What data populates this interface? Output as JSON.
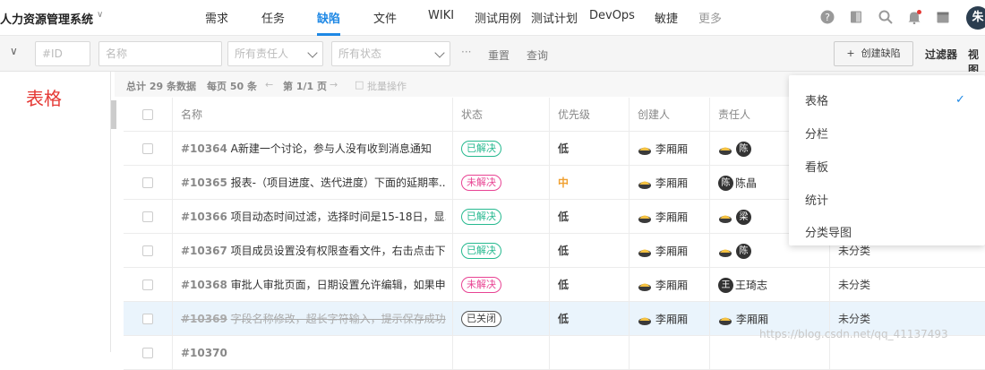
{
  "app": {
    "title": "人力资源管理系统"
  },
  "nav": {
    "items": [
      "需求",
      "任务",
      "缺陷",
      "文件",
      "WIKI",
      "测试用例",
      "测试计划",
      "DevOps",
      "敏捷",
      "更多"
    ],
    "active": "缺陷"
  },
  "user": {
    "avatar_letter": "朱"
  },
  "toolbar": {
    "id_placeholder": "#ID",
    "name_placeholder": "名称",
    "assignee_placeholder": "所有责任人",
    "status_placeholder": "所有状态",
    "more": "···",
    "reset": "重置",
    "query": "查询",
    "create_bug": "创建缺陷",
    "filter": "过滤器",
    "view": "视图"
  },
  "left_panel": {
    "annotation": "表格"
  },
  "summary": {
    "total": "总计 29 条数据",
    "per_page": "每页 50 条",
    "page": "第 1/1 页",
    "batch": "批量操作"
  },
  "table": {
    "columns": [
      "名称",
      "状态",
      "优先级",
      "创建人",
      "责任人"
    ],
    "rows": [
      {
        "id": "#10364",
        "title": "A新建一个讨论，参与人没有收到消息通知",
        "status": "已解决",
        "status_type": "solved",
        "priority": "低",
        "creator": "李厢厢",
        "assignee_initial": "陈",
        "assignee": "",
        "category": "",
        "highlight": false
      },
      {
        "id": "#10365",
        "title": "报表-（项目进度、迭代进度）下面的延期率...",
        "status": "未解决",
        "status_type": "unsolved",
        "priority": "中",
        "creator": "李厢厢",
        "assignee_initial": "陈",
        "assignee": "陈晶",
        "category": "",
        "highlight": false
      },
      {
        "id": "#10366",
        "title": "项目动态时间过滤，选择时间是15-18日，显...",
        "status": "已解决",
        "status_type": "solved",
        "priority": "低",
        "creator": "李厢厢",
        "assignee_initial": "梁",
        "assignee": "",
        "category": "",
        "highlight": false
      },
      {
        "id": "#10367",
        "title": "项目成员设置没有权限查看文件，右击点击下...",
        "status": "已解决",
        "status_type": "solved",
        "priority": "低",
        "creator": "李厢厢",
        "assignee_initial": "陈",
        "assignee": "",
        "category": "未分类",
        "highlight": false
      },
      {
        "id": "#10368",
        "title": "审批人审批页面，日期设置允许编辑，如果申...",
        "status": "未解决",
        "status_type": "unsolved",
        "priority": "低",
        "creator": "李厢厢",
        "assignee_initial": "王",
        "assignee": "王琦志",
        "category": "未分类",
        "highlight": false
      },
      {
        "id": "#10369",
        "title": "字段名称修改，超长字符输入，提示保存成功",
        "status": "已关闭",
        "status_type": "closed",
        "priority": "低",
        "creator": "李厢厢",
        "assignee_initial": "",
        "assignee": "李厢厢",
        "category": "未分类",
        "highlight": true
      },
      {
        "id": "#10370",
        "title": "",
        "status": "",
        "status_type": "unsolved",
        "priority": "",
        "creator": "",
        "assignee_initial": "",
        "assignee": "",
        "category": "",
        "highlight": false
      }
    ]
  },
  "view_menu": {
    "items": [
      "表格",
      "分栏",
      "看板",
      "统计",
      "分类导图"
    ],
    "selected": "表格"
  },
  "watermark": "https://blog.csdn.net/qq_41137493",
  "colors": {
    "accent": "#1e88e5",
    "solved": "#26b98f",
    "unsolved": "#e84393",
    "annotation": "#e53935"
  }
}
